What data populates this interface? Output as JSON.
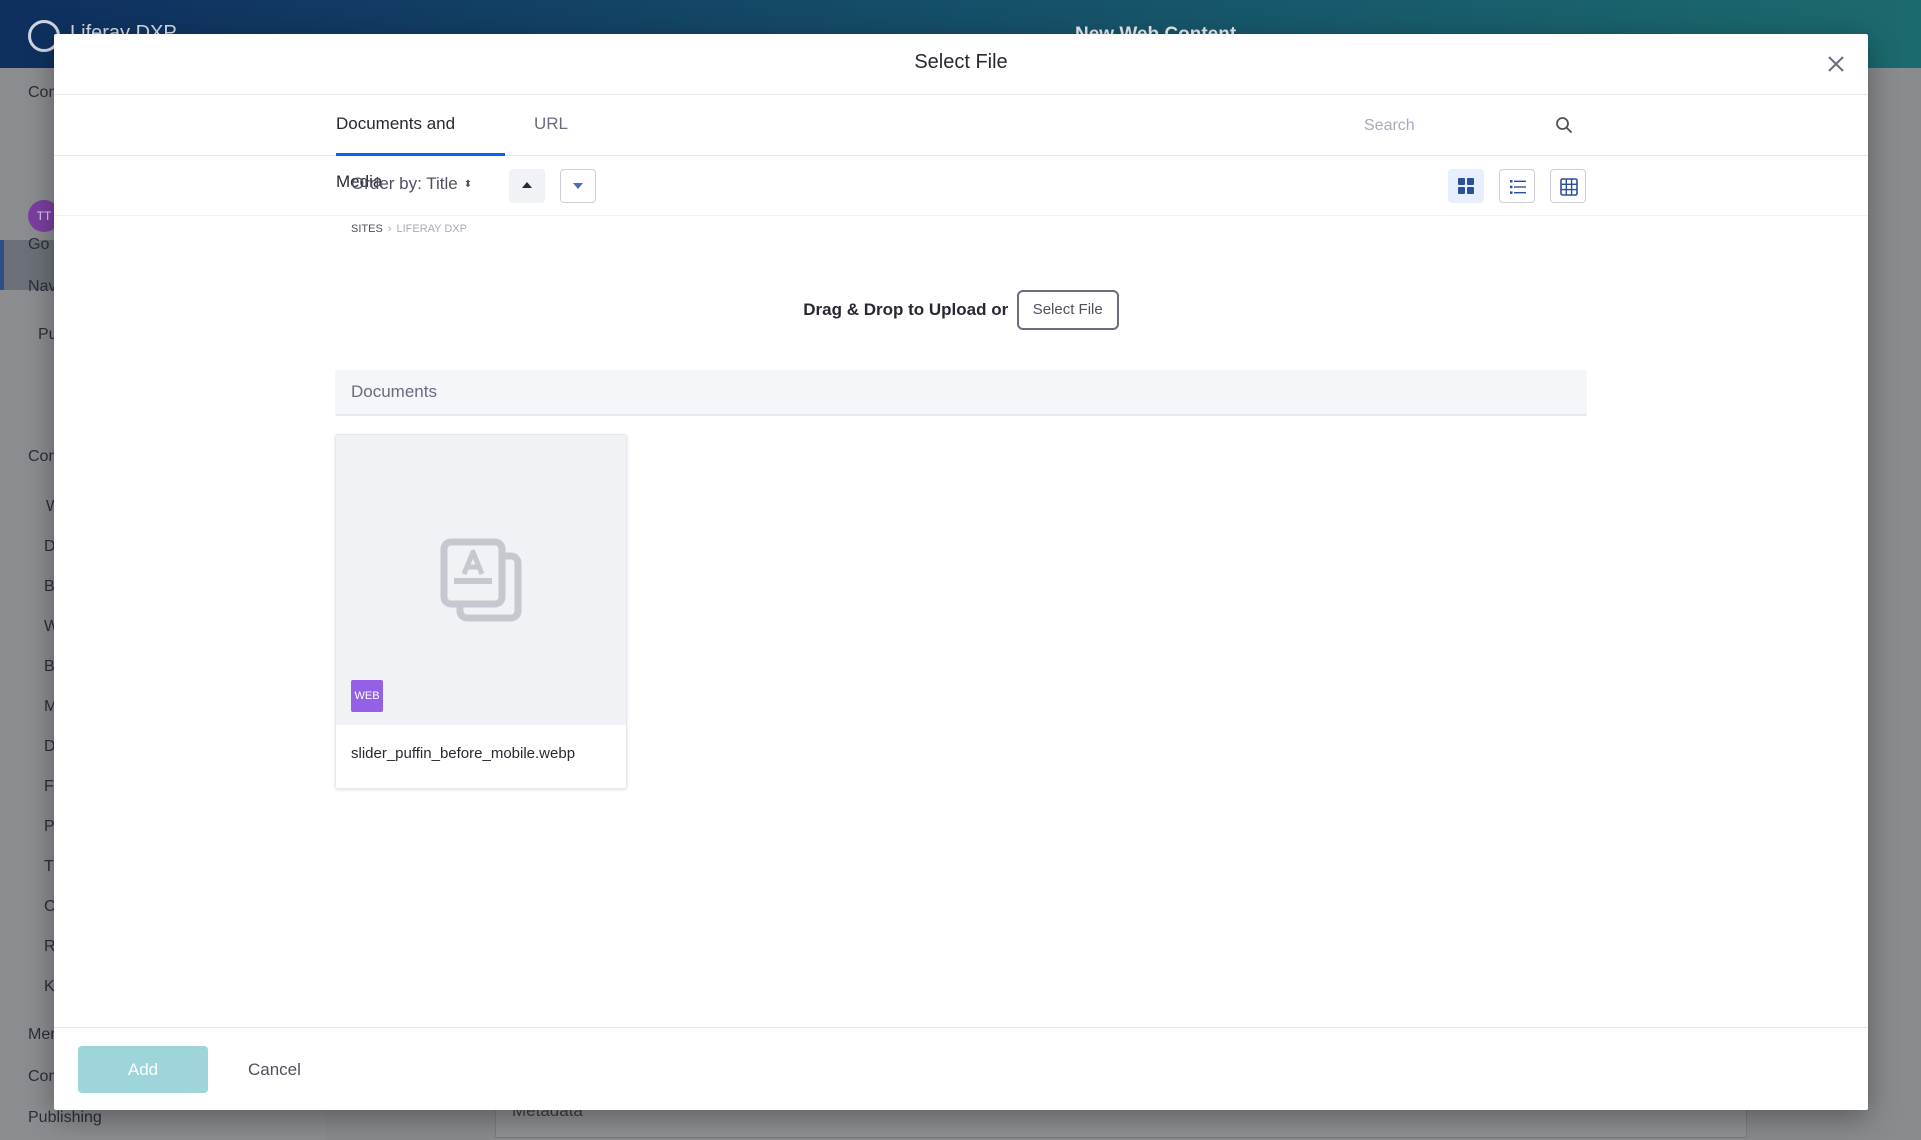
{
  "background": {
    "brand": "Liferay DXP",
    "page_title": "New Web Content",
    "avatar_initials": "TT",
    "sidebar_items": [
      "Con",
      "Go t",
      "Nav",
      "Pu",
      "Con",
      "W",
      "D",
      "B",
      "W",
      "B",
      "M",
      "D",
      "F",
      "P",
      "T",
      "C",
      "R",
      "K",
      "Mer",
      "Con",
      "Publishing"
    ],
    "metadata_label": "Metadata"
  },
  "modal": {
    "title": "Select File",
    "tabs": [
      {
        "label": "Documents and Media",
        "active": true
      },
      {
        "label": "URL",
        "active": false
      }
    ],
    "search": {
      "placeholder": "Search",
      "value": ""
    },
    "toolbar": {
      "order_by_label": "Order by: Title",
      "views": [
        "cards",
        "list",
        "table"
      ],
      "active_view": "cards"
    },
    "breadcrumb": {
      "root": "Sites",
      "current": "Liferay DXP"
    },
    "dropzone": {
      "text": "Drag & Drop to Upload or",
      "button_label": "Select File"
    },
    "documents": {
      "section_label": "Documents",
      "items": [
        {
          "title": "slider_puffin_before_mobile.webp",
          "badge": "WEB",
          "badge_color": "#9360e6"
        }
      ]
    },
    "footer": {
      "add_label": "Add",
      "cancel_label": "Cancel"
    }
  },
  "colors": {
    "accent": "#0b5fff",
    "add_button": "#9ed5da",
    "badge": "#9360e6"
  }
}
